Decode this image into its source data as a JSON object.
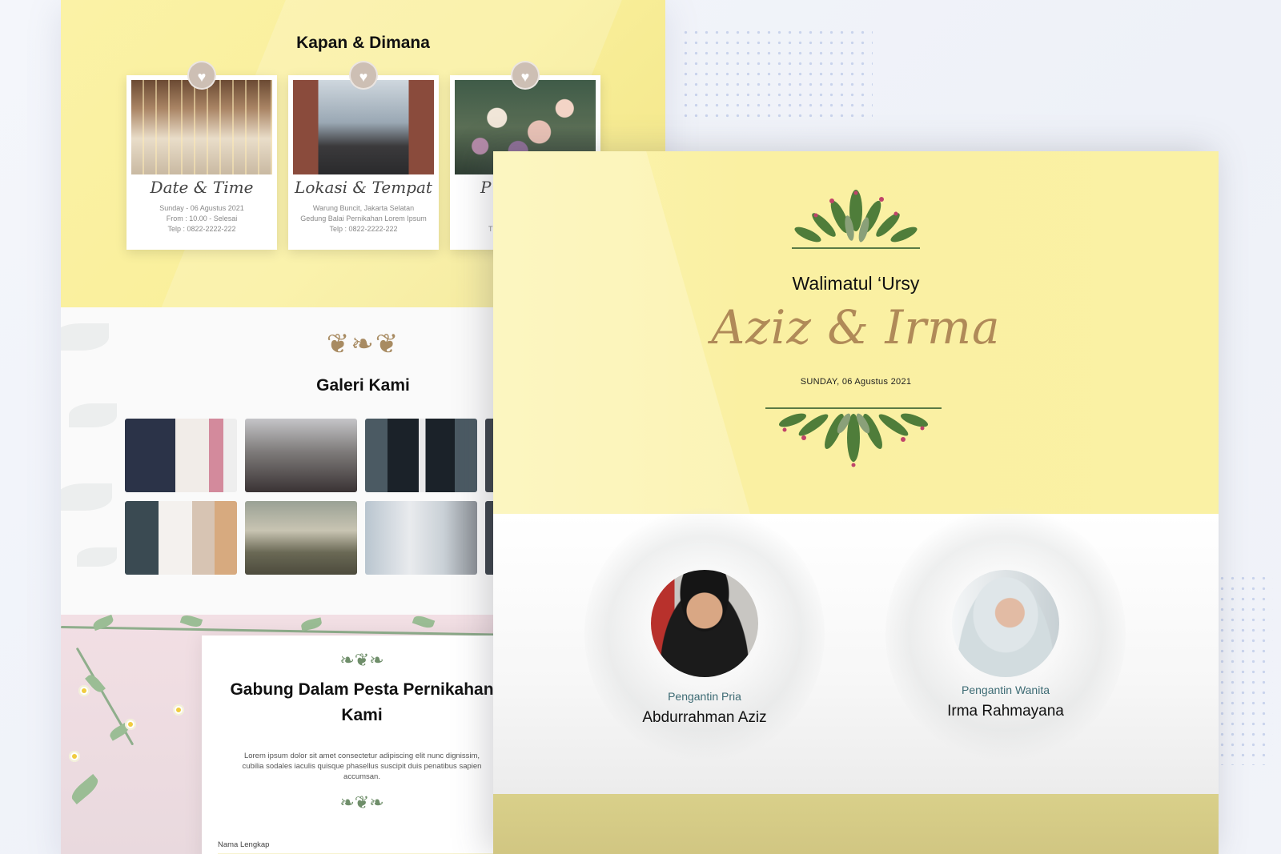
{
  "venue": {
    "title": "Kapan & Dimana",
    "cards": [
      {
        "title": "Date & Time",
        "lines": [
          "Sunday - 06 Agustus 2021",
          "From : 10.00 - Selesai",
          "Telp : 0822-2222-222"
        ]
      },
      {
        "title": "Lokasi & Tempat",
        "lines": [
          "Warung Buncit, Jakarta Selatan",
          "Gedung Balai Pernikahan Lorem Ipsum",
          "Telp : 0822-2222-222"
        ]
      },
      {
        "title": "P",
        "lines": [
          "",
          "",
          "T"
        ]
      }
    ],
    "badge_icon": "heart-icon"
  },
  "gallery": {
    "title": "Galeri Kami"
  },
  "rsvp": {
    "title_line1": "Gabung Dalam Pesta Pernikahan",
    "title_line2": "Kami",
    "text": "Lorem ipsum dolor sit amet consectetur adipiscing elit nunc dignissim, cubilia sodales iaculis quisque phasellus suscipit duis penatibus sapien accumsan.",
    "name_label": "Nama Lengkap"
  },
  "hero": {
    "eyebrow": "Walimatul ‘Ursy",
    "names": "Aziz & Irma",
    "date": "SUNDAY, 06 Agustus 2021"
  },
  "couple": {
    "groom": {
      "role": "Pengantin Pria",
      "name": "Abdurrahman Aziz"
    },
    "bride": {
      "role": "Pengantin Wanita",
      "name": "Irma Rahmayana"
    }
  },
  "colors": {
    "accent_yellow": "#faf0a2",
    "name_gold": "#b08a58",
    "role_teal": "#3d6b74",
    "footer_olive": "#d5cb85"
  }
}
